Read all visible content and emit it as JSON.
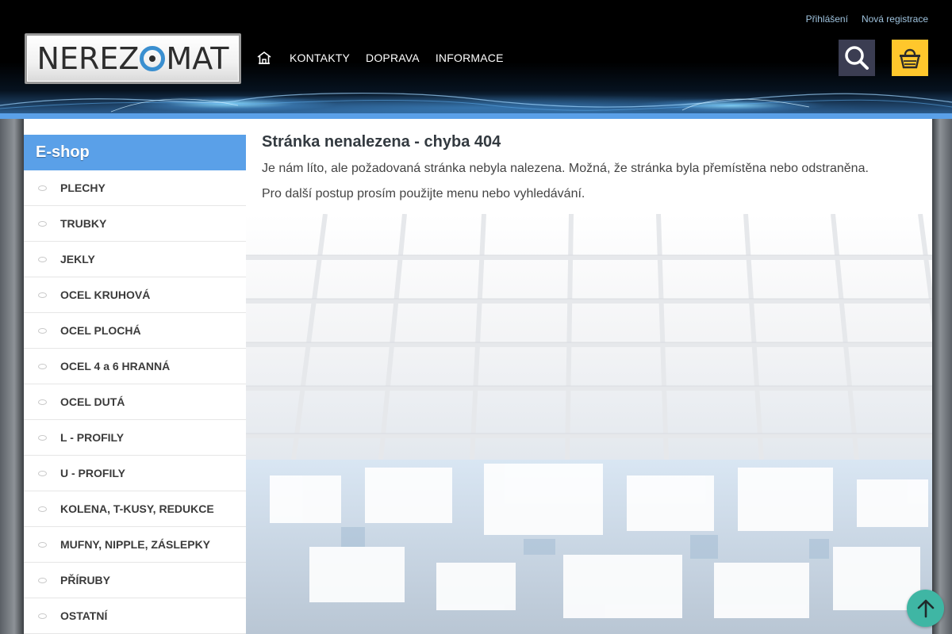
{
  "logo": {
    "text_before": "NEREZ",
    "text_after": "MAT"
  },
  "top_links": {
    "login": "Přihlášení",
    "register": "Nová registrace"
  },
  "nav": {
    "home_icon": "home-icon",
    "items": [
      {
        "label": "KONTAKTY"
      },
      {
        "label": "DOPRAVA"
      },
      {
        "label": "INFORMACE"
      }
    ]
  },
  "header_buttons": {
    "search_icon": "search-icon",
    "cart_icon": "basket-icon"
  },
  "sidebar": {
    "heading": "E-shop",
    "items": [
      {
        "label": "PLECHY"
      },
      {
        "label": "TRUBKY"
      },
      {
        "label": "JEKLY"
      },
      {
        "label": "OCEL KRUHOVÁ"
      },
      {
        "label": "OCEL PLOCHÁ"
      },
      {
        "label": "OCEL 4 a 6 HRANNÁ"
      },
      {
        "label": "OCEL DUTÁ"
      },
      {
        "label": "L - PROFILY"
      },
      {
        "label": "U - PROFILY"
      },
      {
        "label": "KOLENA, T-KUSY, REDUKCE"
      },
      {
        "label": "MUFNY, NIPPLE, ZÁSLEPKY"
      },
      {
        "label": "PŘÍRUBY"
      },
      {
        "label": "OSTATNÍ"
      }
    ]
  },
  "main": {
    "title": "Stránka nenalezena - chyba 404",
    "message": "Je nám líto, ale požadovaná stránka nebyla nalezena. Možná, že stránka byla přemístěna nebo odstraněna.",
    "hint": "Pro další postup prosím použijte menu nebo vyhledávání."
  },
  "scroll_top_icon": "arrow-up-icon",
  "colors": {
    "accent_blue": "#5aa0e8",
    "search_bg": "#3b3d52",
    "cart_bg": "#ffc72c",
    "scroll_top_bg": "#3fb6a4"
  }
}
